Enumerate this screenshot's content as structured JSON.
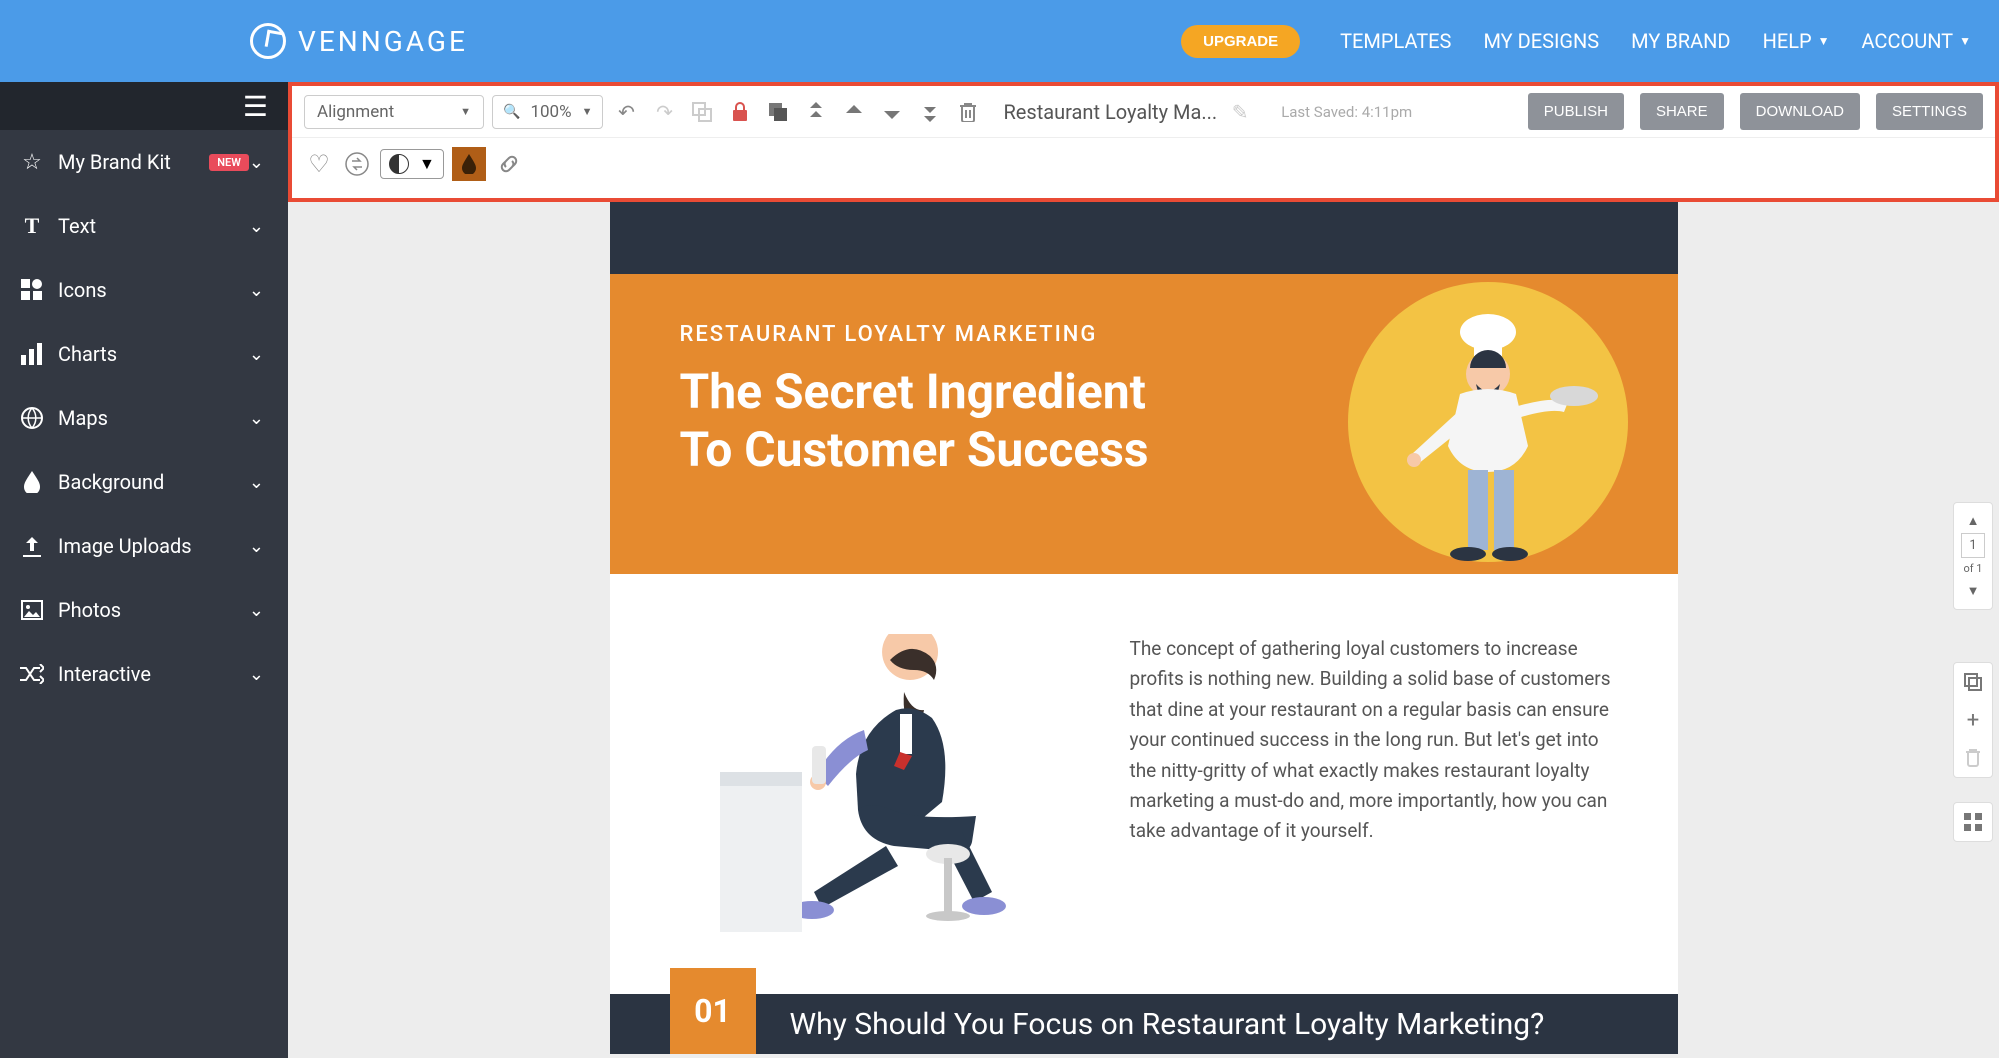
{
  "brand": "VENNGAGE",
  "topnav": {
    "upgrade": "UPGRADE",
    "links": [
      {
        "label": "TEMPLATES",
        "caret": false
      },
      {
        "label": "MY DESIGNS",
        "caret": false
      },
      {
        "label": "MY BRAND",
        "caret": false
      },
      {
        "label": "HELP",
        "caret": true
      },
      {
        "label": "ACCOUNT",
        "caret": true
      }
    ]
  },
  "sidebar": {
    "items": [
      {
        "icon": "star",
        "label": "My Brand Kit",
        "badge": "NEW"
      },
      {
        "icon": "text",
        "label": "Text"
      },
      {
        "icon": "icons",
        "label": "Icons"
      },
      {
        "icon": "charts",
        "label": "Charts"
      },
      {
        "icon": "maps",
        "label": "Maps"
      },
      {
        "icon": "background",
        "label": "Background"
      },
      {
        "icon": "upload",
        "label": "Image Uploads"
      },
      {
        "icon": "photos",
        "label": "Photos"
      },
      {
        "icon": "interactive",
        "label": "Interactive"
      }
    ]
  },
  "toolbar": {
    "alignment_label": "Alignment",
    "zoom_label": "100%",
    "doc_title": "Restaurant Loyalty Ma...",
    "last_saved_label": "Last Saved: 4:11pm",
    "actions": {
      "publish": "PUBLISH",
      "share": "SHARE",
      "download": "DOWNLOAD",
      "settings": "SETTINGS"
    }
  },
  "pagecontrols": {
    "current": "1",
    "of_label": "of 1"
  },
  "infographic": {
    "kicker": "RESTAURANT LOYALTY MARKETING",
    "title_line1": "The Secret Ingredient",
    "title_line2": "To Customer Success",
    "body_paragraph": "The concept of gathering loyal customers to increase profits is nothing new. Building a solid base of customers that dine at your restaurant on a regular basis can ensure your continued success in the long run. But let's get into the nitty-gritty of what exactly makes restaurant loyalty marketing a must-do and, more importantly, how you can take advantage of it yourself.",
    "section_num": "01",
    "section_title": "Why Should You Focus on Restaurant Loyalty Marketing?"
  }
}
